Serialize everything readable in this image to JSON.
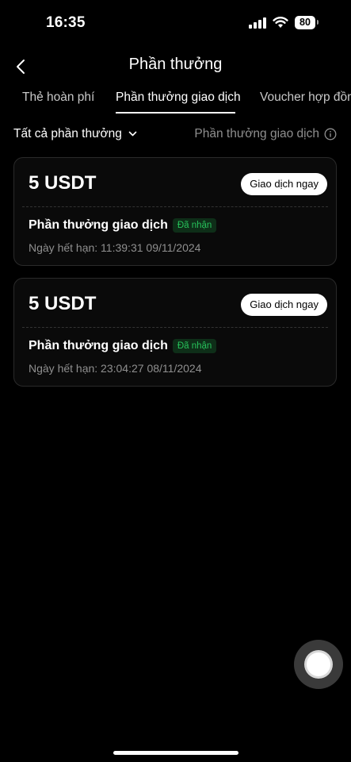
{
  "status_bar": {
    "time": "16:35",
    "battery": "80",
    "icons": [
      "signal-icon",
      "wifi-icon",
      "battery-icon"
    ]
  },
  "header": {
    "title": "Phần thưởng",
    "back_icon": "chevron-left-icon"
  },
  "tabs": [
    {
      "label": "Thẻ hoàn phí",
      "active": false
    },
    {
      "label": "Phần thưởng giao dịch",
      "active": true
    },
    {
      "label": "Voucher hợp đồn",
      "active": false
    }
  ],
  "filter": {
    "dropdown_label": "Tất cả phần thưởng",
    "right_label": "Phần thưởng giao dịch"
  },
  "cards": [
    {
      "amount": "5 USDT",
      "button_label": "Giao dịch ngay",
      "reward_name": "Phần thưởng giao dịch",
      "status": "Đã nhận",
      "expiry": "Ngày hết hạn: 11:39:31 09/11/2024"
    },
    {
      "amount": "5 USDT",
      "button_label": "Giao dịch ngay",
      "reward_name": "Phần thưởng giao dịch",
      "status": "Đã nhận",
      "expiry": "Ngày hết hạn: 23:04:27 08/11/2024"
    }
  ],
  "colors": {
    "background": "#000000",
    "status_green": "#27c15a",
    "muted_text": "#8f8f8f"
  }
}
